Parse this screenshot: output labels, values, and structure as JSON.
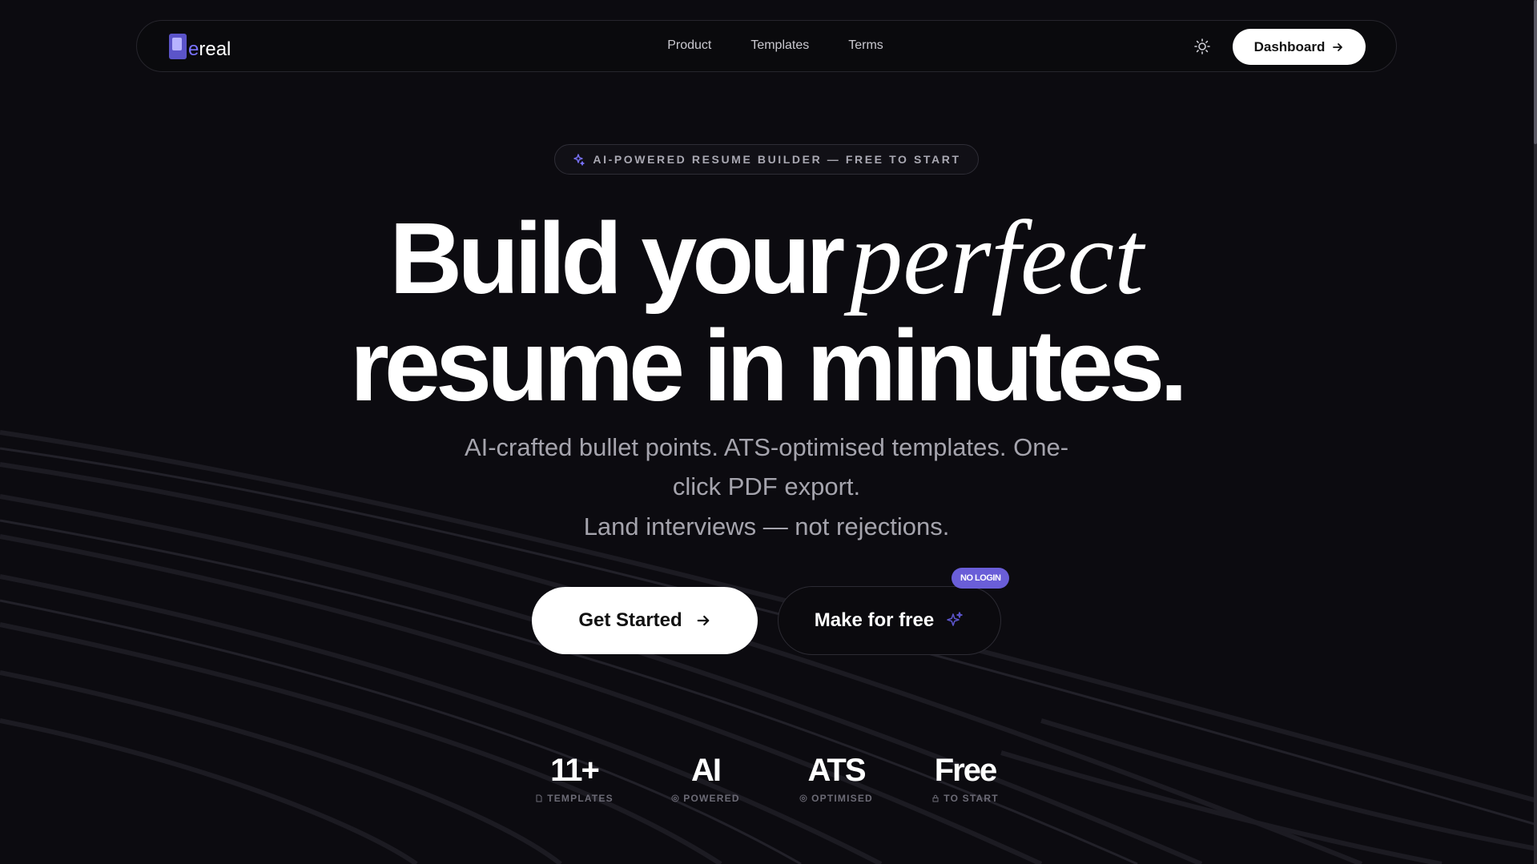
{
  "nav": {
    "logo_prefix": "e",
    "logo_suffix": "real",
    "links": [
      "Product",
      "Templates",
      "Terms"
    ],
    "dashboard_label": "Dashboard"
  },
  "hero": {
    "pill_text": "AI-POWERED RESUME BUILDER — FREE TO START",
    "headline_line1": "Build your",
    "headline_accent": "perfect",
    "headline_line2": "resume in minutes.",
    "sub_line1": "AI-crafted bullet points. ATS-optimised templates. One-",
    "sub_line2": "click PDF export.",
    "sub_line3": "Land interviews — not rejections.",
    "cta_primary": "Get Started",
    "cta_secondary": "Make for free",
    "badge": "NO LOGIN"
  },
  "stats": [
    {
      "value": "11+",
      "label": "TEMPLATES",
      "icon": "document-icon"
    },
    {
      "value": "AI",
      "label": "POWERED",
      "icon": "chip-icon"
    },
    {
      "value": "ATS",
      "label": "OPTIMISED",
      "icon": "target-icon"
    },
    {
      "value": "Free",
      "label": "TO START",
      "icon": "lock-icon"
    }
  ],
  "colors": {
    "background": "#0c0b10",
    "accent": "#6a5ed8",
    "text_muted": "#a5a4ad"
  }
}
